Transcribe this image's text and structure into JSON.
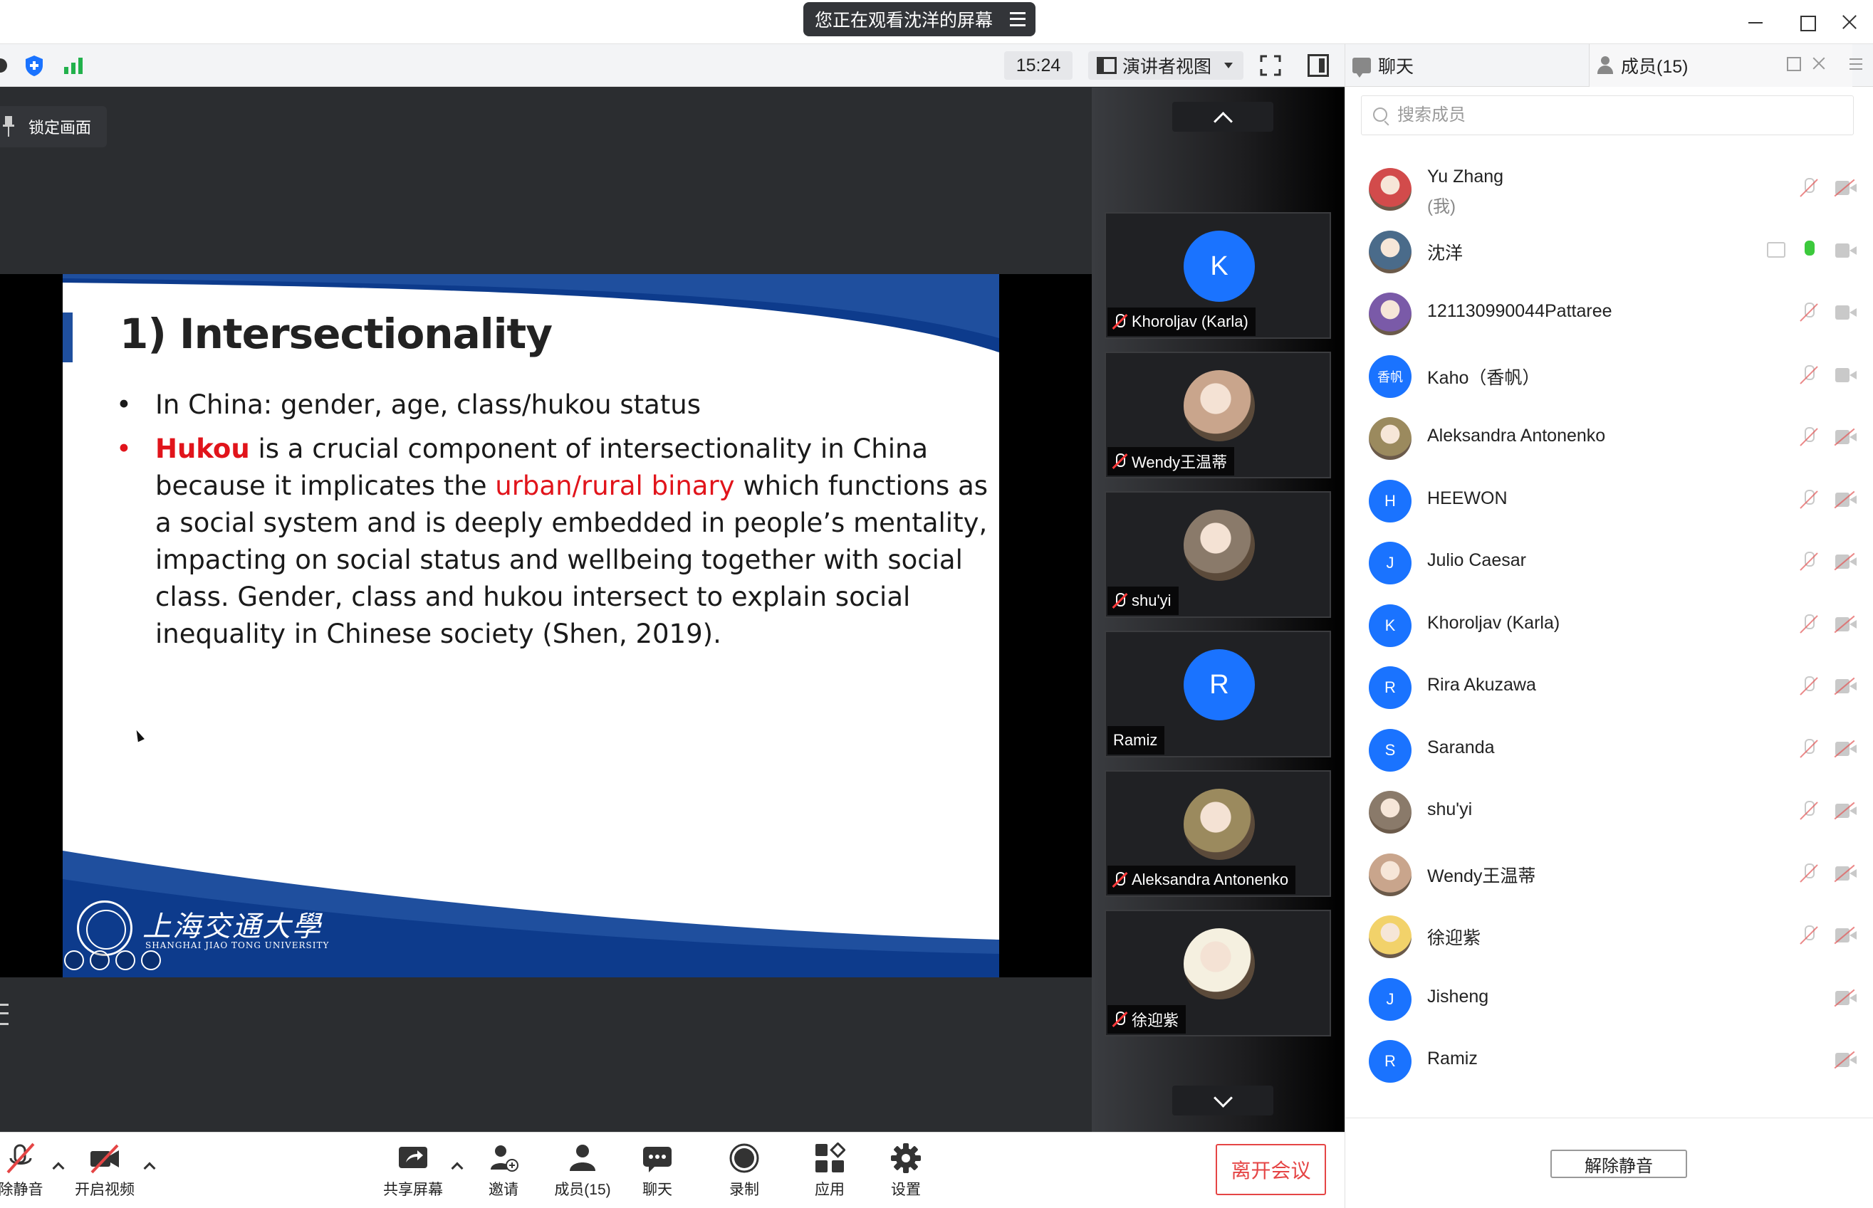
{
  "window": {
    "sharing_banner": "您正在观看沈洋的屏幕"
  },
  "toolbar": {
    "time": "15:24",
    "view_mode": "演讲者视图"
  },
  "stage": {
    "lock_screen_label": "锁定画面"
  },
  "slide": {
    "title": "1) Intersectionality",
    "bullet1": "In China: gender, age, class/hukou status",
    "bullet2_hukou": "Hukou",
    "bullet2_part1": " is a crucial component of intersectionality in China because it implicates the ",
    "bullet2_highlight": "urban/rural binary",
    "bullet2_part2": " which functions as a social system and is deeply embedded in people’s mentality, impacting on social status and wellbeing together with social class. Gender, class and hukou intersect to explain social inequality in Chinese society (Shen, 2019).",
    "logo_cn": "上海交通大學",
    "logo_en": "SHANGHAI JIAO TONG UNIVERSITY"
  },
  "gallery": [
    {
      "name": "Khoroljav (Karla)",
      "initial": "K",
      "muted": true,
      "photo": false
    },
    {
      "name": "Wendy王温蒂",
      "initial": "",
      "muted": true,
      "photo": true,
      "color": "#c9a58c"
    },
    {
      "name": "shu'yi",
      "initial": "",
      "muted": true,
      "photo": true,
      "color": "#8a7a6a"
    },
    {
      "name": "Ramiz",
      "initial": "R",
      "muted": false,
      "photo": false
    },
    {
      "name": "Aleksandra Antonenko",
      "initial": "",
      "muted": true,
      "photo": true,
      "color": "#9b8a5e"
    },
    {
      "name": "徐迎紫",
      "initial": "",
      "muted": true,
      "photo": true,
      "color": "#f5f0e0"
    }
  ],
  "panel": {
    "chat_tab": "聊天",
    "members_tab": "成员(15)",
    "search_placeholder": "搜索成员",
    "unmute_all": "解除静音"
  },
  "members": [
    {
      "name": "Yu Zhang",
      "sub": "(我)",
      "avatar": "",
      "color": "#d24b4b",
      "mic": "off",
      "cam": "off",
      "share": false
    },
    {
      "name": "沈洋",
      "sub": "",
      "avatar": "",
      "color": "#4a6b8a",
      "mic": "on",
      "cam": "on",
      "share": true
    },
    {
      "name": "121130990044Pattaree",
      "sub": "",
      "avatar": "",
      "color": "#7a5aa8",
      "mic": "off",
      "cam": "on",
      "share": false
    },
    {
      "name": "Kaho（香帆）",
      "sub": "",
      "avatar": "香帆",
      "color": "#1a73ff",
      "mic": "off",
      "cam": "on",
      "share": false
    },
    {
      "name": "Aleksandra Antonenko",
      "sub": "",
      "avatar": "",
      "color": "#9b8a5e",
      "mic": "off",
      "cam": "off",
      "share": false
    },
    {
      "name": "HEEWON",
      "sub": "",
      "avatar": "H",
      "color": "#1a73ff",
      "mic": "off",
      "cam": "off",
      "share": false
    },
    {
      "name": "Julio Caesar",
      "sub": "",
      "avatar": "J",
      "color": "#1a73ff",
      "mic": "off",
      "cam": "off",
      "share": false
    },
    {
      "name": "Khoroljav (Karla)",
      "sub": "",
      "avatar": "K",
      "color": "#1a73ff",
      "mic": "off",
      "cam": "off",
      "share": false
    },
    {
      "name": "Rira Akuzawa",
      "sub": "",
      "avatar": "R",
      "color": "#1a73ff",
      "mic": "off",
      "cam": "off",
      "share": false
    },
    {
      "name": "Saranda",
      "sub": "",
      "avatar": "S",
      "color": "#1a73ff",
      "mic": "off",
      "cam": "off",
      "share": false
    },
    {
      "name": "shu'yi",
      "sub": "",
      "avatar": "",
      "color": "#8a7a6a",
      "mic": "off",
      "cam": "off",
      "share": false
    },
    {
      "name": "Wendy王温蒂",
      "sub": "",
      "avatar": "",
      "color": "#c9a58c",
      "mic": "off",
      "cam": "off",
      "share": false
    },
    {
      "name": "徐迎紫",
      "sub": "",
      "avatar": "",
      "color": "#f2d26a",
      "mic": "off",
      "cam": "off",
      "share": false
    },
    {
      "name": "Jisheng",
      "sub": "",
      "avatar": "J",
      "color": "#1a73ff",
      "mic": "none",
      "cam": "off",
      "share": false
    },
    {
      "name": "Ramiz",
      "sub": "",
      "avatar": "R",
      "color": "#1a73ff",
      "mic": "none",
      "cam": "off",
      "share": false
    }
  ],
  "controls": {
    "unmute": "除静音",
    "start_video": "开启视频",
    "share_screen": "共享屏幕",
    "invite": "邀请",
    "members": "成员(15)",
    "chat": "聊天",
    "record": "录制",
    "apps": "应用",
    "settings": "设置",
    "leave": "离开会议"
  },
  "colors": {
    "accent_blue": "#1a73ff",
    "slide_blue": "#1f4f9e",
    "highlight_red": "#e1141b",
    "leave_red": "#e54545"
  }
}
